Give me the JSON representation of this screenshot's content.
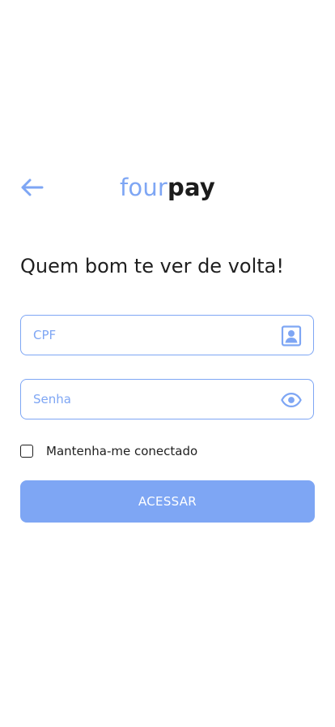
{
  "header": {
    "logo_part1": "four",
    "logo_part2": "pay",
    "back_icon": "arrow-left-icon"
  },
  "greeting": "Quem bom te ver de volta!",
  "form": {
    "cpf": {
      "placeholder": "CPF",
      "value": "",
      "icon": "contact-card-icon"
    },
    "senha": {
      "placeholder": "Senha",
      "value": "",
      "icon": "eye-icon"
    },
    "remember_label": "Mantenha-me conectado",
    "remember_checked": false,
    "submit_label": "ACESSAR"
  },
  "colors": {
    "accent": "#7ea6f4",
    "text": "#1f1f1f",
    "background": "#ffffff"
  }
}
